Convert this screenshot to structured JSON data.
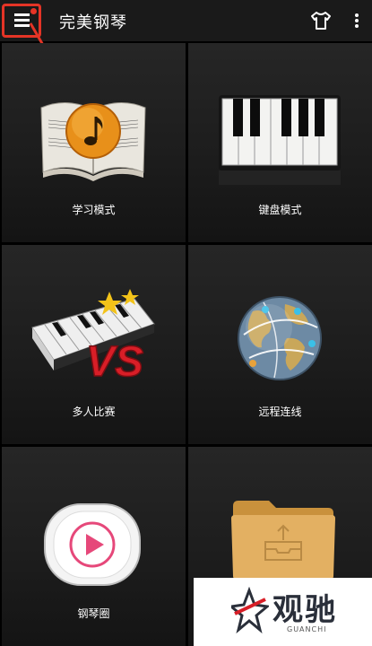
{
  "app": {
    "title": "完美钢琴"
  },
  "tiles": [
    {
      "label": "学习模式",
      "icon": "music-book-icon"
    },
    {
      "label": "键盘模式",
      "icon": "piano-keyboard-icon"
    },
    {
      "label": "多人比赛",
      "icon": "piano-vs-icon"
    },
    {
      "label": "远程连线",
      "icon": "globe-network-icon"
    },
    {
      "label": "钢琴圈",
      "icon": "play-circle-icon"
    },
    {
      "label": "",
      "icon": "folder-icon"
    }
  ],
  "watermark": {
    "text": "观驰",
    "subtext": "GUANCHI"
  },
  "colors": {
    "highlight": "#e53426",
    "background": "#000000",
    "appbar": "#1a1a1a"
  }
}
